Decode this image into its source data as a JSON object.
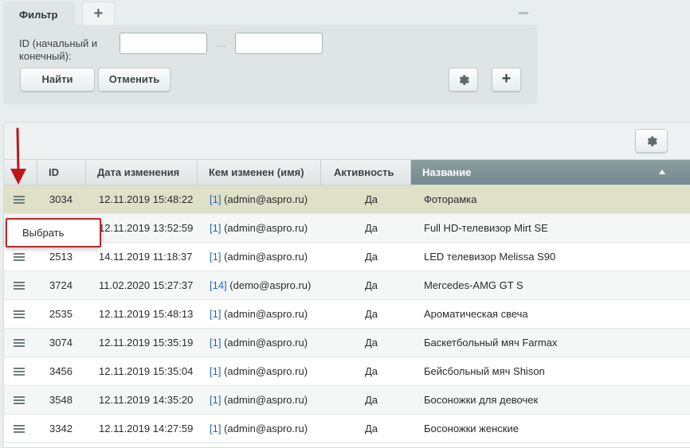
{
  "filter": {
    "tab_label": "Фильтр",
    "add_tab_label": "+",
    "field_label": "ID (начальный и конечный):",
    "range_separator": "...",
    "from_value": "",
    "to_value": "",
    "find_label": "Найти",
    "cancel_label": "Отменить",
    "add_label": "+"
  },
  "grid": {
    "columns": {
      "id": "ID",
      "date": "Дата изменения",
      "author": "Кем изменен (имя)",
      "active": "Активность",
      "name": "Название"
    },
    "sort_column": "Название",
    "sort_direction": "asc",
    "rows": [
      {
        "id": "3034",
        "date": "12.11.2019 15:48:22",
        "author_id": "[1]",
        "author_name": " (admin@aspro.ru)",
        "active": "Да",
        "name": "Фоторамка"
      },
      {
        "id": "",
        "date": "12.11.2019 13:52:59",
        "author_id": "[1]",
        "author_name": " (admin@aspro.ru)",
        "active": "Да",
        "name": "Full HD-телевизор Mirt SE"
      },
      {
        "id": "2513",
        "date": "14.11.2019 11:18:37",
        "author_id": "[1]",
        "author_name": " (admin@aspro.ru)",
        "active": "Да",
        "name": "LED телевизор Melissa S90"
      },
      {
        "id": "3724",
        "date": "11.02.2020 15:27:37",
        "author_id": "[14]",
        "author_name": " (demo@aspro.ru)",
        "active": "Да",
        "name": "Mercedes-AMG GT S"
      },
      {
        "id": "2535",
        "date": "12.11.2019 15:48:13",
        "author_id": "[1]",
        "author_name": " (admin@aspro.ru)",
        "active": "Да",
        "name": "Ароматическая свеча"
      },
      {
        "id": "3074",
        "date": "12.11.2019 15:35:19",
        "author_id": "[1]",
        "author_name": " (admin@aspro.ru)",
        "active": "Да",
        "name": "Баскетбольный мяч Farmax"
      },
      {
        "id": "3456",
        "date": "12.11.2019 15:35:04",
        "author_id": "[1]",
        "author_name": " (admin@aspro.ru)",
        "active": "Да",
        "name": "Бейсбольный мяч Shison"
      },
      {
        "id": "3548",
        "date": "12.11.2019 14:35:20",
        "author_id": "[1]",
        "author_name": " (admin@aspro.ru)",
        "active": "Да",
        "name": "Босоножки для девочек"
      },
      {
        "id": "3342",
        "date": "12.11.2019 14:27:59",
        "author_id": "[1]",
        "author_name": " (admin@aspro.ru)",
        "active": "Да",
        "name": "Босоножки женские"
      }
    ]
  },
  "popup": {
    "select_label": "Выбрать"
  },
  "colors": {
    "accent_border": "#b52a30",
    "arrow": "#c0161d",
    "link": "#2067b0",
    "selected_row": "#dee0c8",
    "sorted_header": "#7f9397"
  },
  "icons": [
    "gear-icon",
    "plus-icon",
    "minus-icon",
    "menu-icon",
    "sort-asc-icon",
    "arrow-down-icon"
  ]
}
